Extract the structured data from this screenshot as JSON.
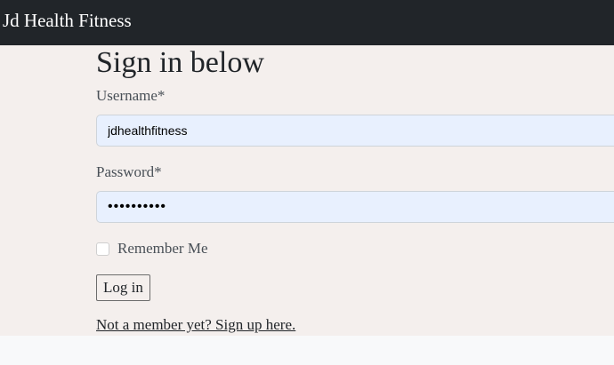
{
  "navbar": {
    "brand": "Jd Health Fitness"
  },
  "form": {
    "title": "Sign in below",
    "username_label": "Username*",
    "username_value": "jdhealthfitness",
    "password_label": "Password*",
    "password_masked": "••••••••••",
    "remember_label": "Remember Me",
    "remember_checked": false,
    "login_label": "Log in",
    "signup_link": "Not a member yet? Sign up here."
  },
  "colors": {
    "navbar_bg": "#212529",
    "page_bg": "#f4efed",
    "input_autofill_bg": "#e8f0fe"
  }
}
